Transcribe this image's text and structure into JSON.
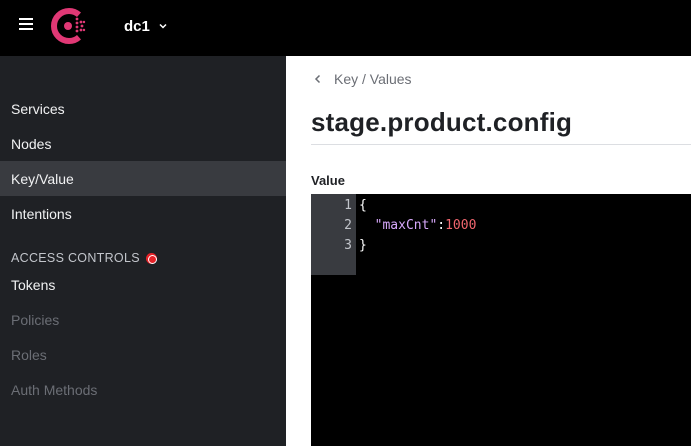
{
  "header": {
    "datacenter": "dc1",
    "brand_color": "#e03875"
  },
  "sidebar": {
    "items": [
      {
        "label": "Services",
        "state": "normal"
      },
      {
        "label": "Nodes",
        "state": "normal"
      },
      {
        "label": "Key/Value",
        "state": "active"
      },
      {
        "label": "Intentions",
        "state": "normal"
      }
    ],
    "section_title": "ACCESS CONTROLS",
    "section_items": [
      {
        "label": "Tokens",
        "state": "normal"
      },
      {
        "label": "Policies",
        "state": "disabled"
      },
      {
        "label": "Roles",
        "state": "disabled"
      },
      {
        "label": "Auth Methods",
        "state": "disabled"
      }
    ]
  },
  "main": {
    "breadcrumb": "Key / Values",
    "title": "stage.product.config",
    "value_label": "Value",
    "editor": {
      "line_numbers": [
        "1",
        "2",
        "3"
      ],
      "lines": [
        {
          "text": "{"
        },
        {
          "indent": "  ",
          "key": "\"maxCnt\"",
          "sep": ":",
          "number": "1000"
        },
        {
          "text": "}"
        }
      ]
    }
  }
}
